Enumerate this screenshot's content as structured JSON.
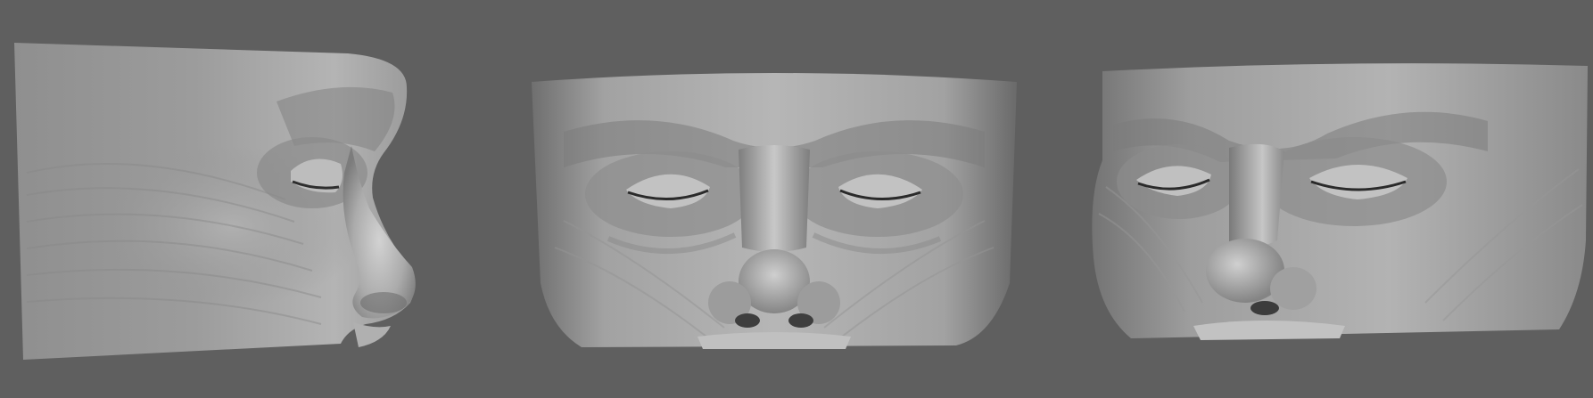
{
  "scene": {
    "background_color": "#5f5f5f",
    "material_color": "#a8a8a8",
    "views": [
      {
        "id": "side",
        "label": ""
      },
      {
        "id": "front",
        "label": ""
      },
      {
        "id": "three-quarter",
        "label": ""
      }
    ]
  }
}
